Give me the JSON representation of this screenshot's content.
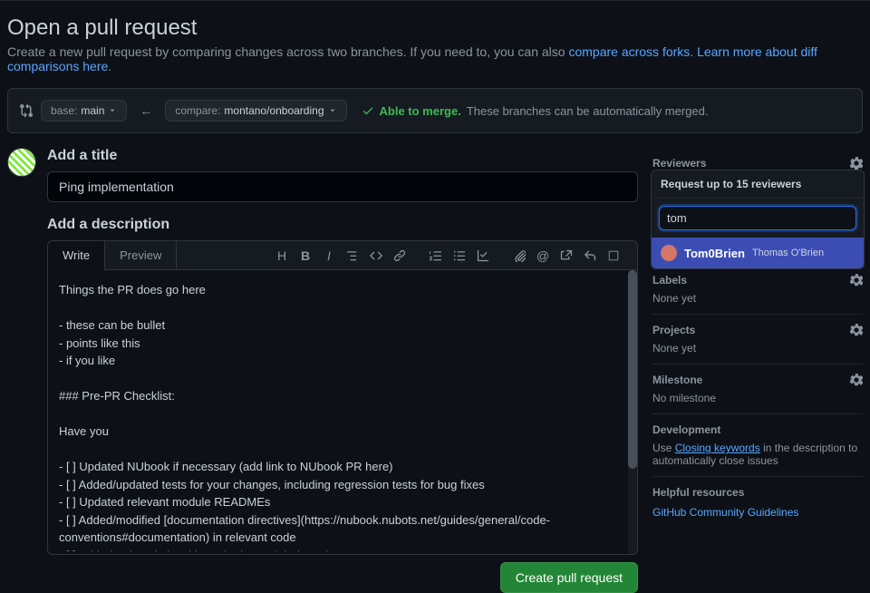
{
  "header": {
    "title": "Open a pull request",
    "subtitle_prefix": "Create a new pull request by comparing changes across two branches. If you need to, you can also ",
    "link1": "compare across forks",
    "dot": ". ",
    "link2": "Learn more about diff comparisons here",
    "period": "."
  },
  "compare": {
    "base_label": "base:",
    "base_value": "main",
    "compare_label": "compare:",
    "compare_value": "montano/onboarding",
    "able": "Able to merge.",
    "auto": "These branches can be automatically merged."
  },
  "form": {
    "title_label": "Add a title",
    "title_value": "Ping implementation",
    "desc_label": "Add a description",
    "tab_write": "Write",
    "tab_preview": "Preview",
    "desc_value": "Things the PR does go here\n\n- these can be bullet\n- points like this\n- if you like\n\n### Pre-PR Checklist:\n\nHave you\n\n- [ ] Updated NUbook if necessary (add link to NUbook PR here)\n- [ ] Added/updated tests for your changes, including regression tests for bug fixes\n- [ ] Updated relevant module READMEs\n- [ ] Added/modified [documentation directives](https://nubook.nubots.net/guides/general/code-conventions#documentation) in relevant code\n- [ ] Added a descriptive title and relevant labels to the PR\n\n### Optional Headings (delete this heading and the ones you don't use)",
    "create_btn": "Create pull request"
  },
  "sidebar": {
    "reviewers": {
      "title": "Reviewers",
      "popup_title": "Request up to 15 reviewers",
      "search_value": "tom",
      "result_user": "Tom0Brien",
      "result_name": "Thomas O'Brien"
    },
    "labels": {
      "title": "Labels",
      "none": "None yet"
    },
    "projects": {
      "title": "Projects",
      "none": "None yet"
    },
    "milestone": {
      "title": "Milestone",
      "none": "No milestone"
    },
    "development": {
      "title": "Development",
      "prefix": "Use ",
      "link": "Closing keywords",
      "suffix": " in the description to automatically close issues"
    },
    "resources": {
      "title": "Helpful resources",
      "link": "GitHub Community Guidelines"
    }
  }
}
